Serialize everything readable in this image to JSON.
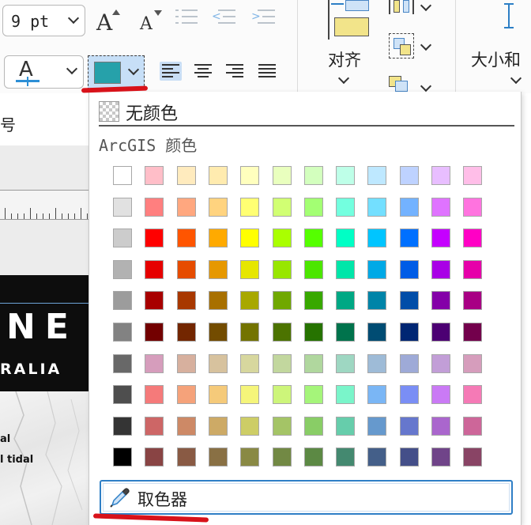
{
  "ribbon": {
    "font_size_value": "9 pt",
    "increase_font_glyph": "A",
    "decrease_font_glyph": "A",
    "font_color_glyph": "A",
    "align_group_label": "对齐",
    "size_group_label": "大小和",
    "fill_color_hex": "#26a1aa"
  },
  "left_panel": {
    "partial_label": "号",
    "map_title_big": "NE",
    "map_title_small": "RALIA",
    "legend_line_1": "al",
    "legend_line_2": "l tidal"
  },
  "color_menu": {
    "no_color_label": "无颜色",
    "section_title": "ArcGIS 颜色",
    "picker_label": "取色器",
    "columns": 12,
    "rows": 10,
    "swatches": [
      [
        "#ffffff",
        "#ffbec8",
        "#ffebbe",
        "#ffebaf",
        "#ffffbe",
        "#e9ffbe",
        "#d3ffbe",
        "#beffe8",
        "#bee8ff",
        "#bed2ff",
        "#e8beff",
        "#ffbee8"
      ],
      [
        "#e1e1e1",
        "#ff7f7f",
        "#ffa77f",
        "#ffd37f",
        "#ffff73",
        "#d1ff73",
        "#a3ff73",
        "#73ffdf",
        "#73dfff",
        "#73b2ff",
        "#df73ff",
        "#ff73df"
      ],
      [
        "#cccccc",
        "#ff0000",
        "#ff5500",
        "#ffaa00",
        "#ffff00",
        "#aaff00",
        "#55ff00",
        "#00ffc5",
        "#00c5ff",
        "#0070ff",
        "#c500ff",
        "#ff00c5"
      ],
      [
        "#b2b2b2",
        "#e60000",
        "#e64c00",
        "#e69800",
        "#e6e600",
        "#98e600",
        "#4ce600",
        "#00e6a9",
        "#00a9e6",
        "#005ce6",
        "#a900e6",
        "#e600a9"
      ],
      [
        "#9c9c9c",
        "#a80000",
        "#a83800",
        "#a87000",
        "#a8a800",
        "#70a800",
        "#38a800",
        "#00a884",
        "#0084a8",
        "#004da8",
        "#8400a8",
        "#a80084"
      ],
      [
        "#828282",
        "#730000",
        "#732600",
        "#734c00",
        "#737300",
        "#4c7300",
        "#267300",
        "#00734c",
        "#004c73",
        "#002673",
        "#4c0073",
        "#73004c"
      ],
      [
        "#686868",
        "#d69dbc",
        "#d7b09e",
        "#d7c29e",
        "#d7d79e",
        "#c2d79e",
        "#b0d79e",
        "#9ed7c2",
        "#9ebbd7",
        "#9eaad7",
        "#c29ed7",
        "#d69dbc"
      ],
      [
        "#4e4e4e",
        "#f57a7a",
        "#f5a27a",
        "#f5ca7a",
        "#f5f57a",
        "#cdf57a",
        "#a5f57a",
        "#7af5ca",
        "#7ab6f5",
        "#7a8ef5",
        "#ca7af5",
        "#f57ab6"
      ],
      [
        "#343434",
        "#cd6666",
        "#cd8966",
        "#cdaa66",
        "#cdcd66",
        "#a4c466",
        "#89cd66",
        "#66cdab",
        "#6699cd",
        "#6677cd",
        "#aa66cd",
        "#cd6699"
      ],
      [
        "#000000",
        "#894444",
        "#895a44",
        "#897044",
        "#898944",
        "#728944",
        "#5c8944",
        "#448970",
        "#445f89",
        "#444f89",
        "#704489",
        "#894465"
      ]
    ]
  }
}
